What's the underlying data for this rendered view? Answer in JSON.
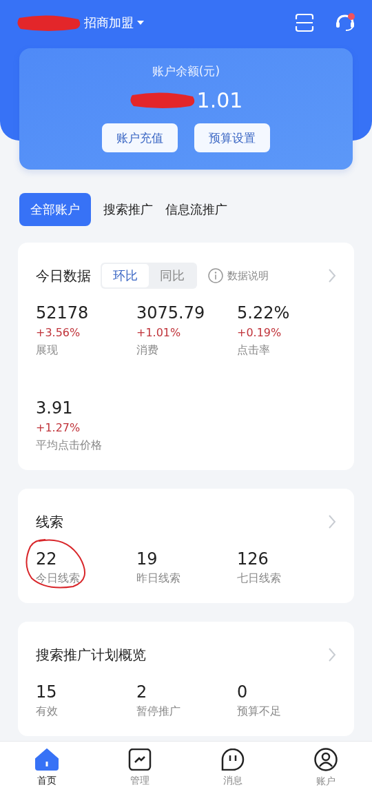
{
  "header": {
    "account_name": "招商加盟",
    "redacted": true
  },
  "balance": {
    "label": "账户余额(元)",
    "amount": "1.01",
    "redacted": true,
    "buttons": [
      "账户充值",
      "预算设置"
    ]
  },
  "account_tabs": [
    {
      "label": "全部账户",
      "selected": true
    },
    {
      "label": "搜索推广",
      "selected": false
    },
    {
      "label": "信息流推广",
      "selected": false
    }
  ],
  "today_data": {
    "title": "今日数据",
    "compare_toggle": [
      {
        "label": "环比",
        "selected": true
      },
      {
        "label": "同比",
        "selected": false
      }
    ],
    "info_link": "数据说明",
    "metrics": [
      {
        "value": "52178",
        "change": "+3.56%",
        "label": "展现"
      },
      {
        "value": "3075.79",
        "change": "+1.01%",
        "label": "消费"
      },
      {
        "value": "5.22%",
        "change": "+0.19%",
        "label": "点击率"
      },
      {
        "value": "3.91",
        "change": "+1.27%",
        "label": "平均点击价格"
      }
    ]
  },
  "leads": {
    "title": "线索",
    "stats": [
      {
        "value": "22",
        "label": "今日线索",
        "annotated": true
      },
      {
        "value": "19",
        "label": "昨日线索",
        "annotated": false
      },
      {
        "value": "126",
        "label": "七日线索",
        "annotated": false
      }
    ]
  },
  "search_plan": {
    "title": "搜索推广计划概览",
    "stats": [
      {
        "value": "15",
        "label": "有效"
      },
      {
        "value": "2",
        "label": "暂停推广"
      },
      {
        "value": "0",
        "label": "预算不足"
      }
    ]
  },
  "bottom_nav": [
    {
      "label": "首页",
      "kind": "home",
      "selected": true
    },
    {
      "label": "管理",
      "kind": "manage",
      "selected": false
    },
    {
      "label": "消息",
      "kind": "message",
      "selected": false
    },
    {
      "label": "账户",
      "kind": "account",
      "selected": false
    }
  ]
}
